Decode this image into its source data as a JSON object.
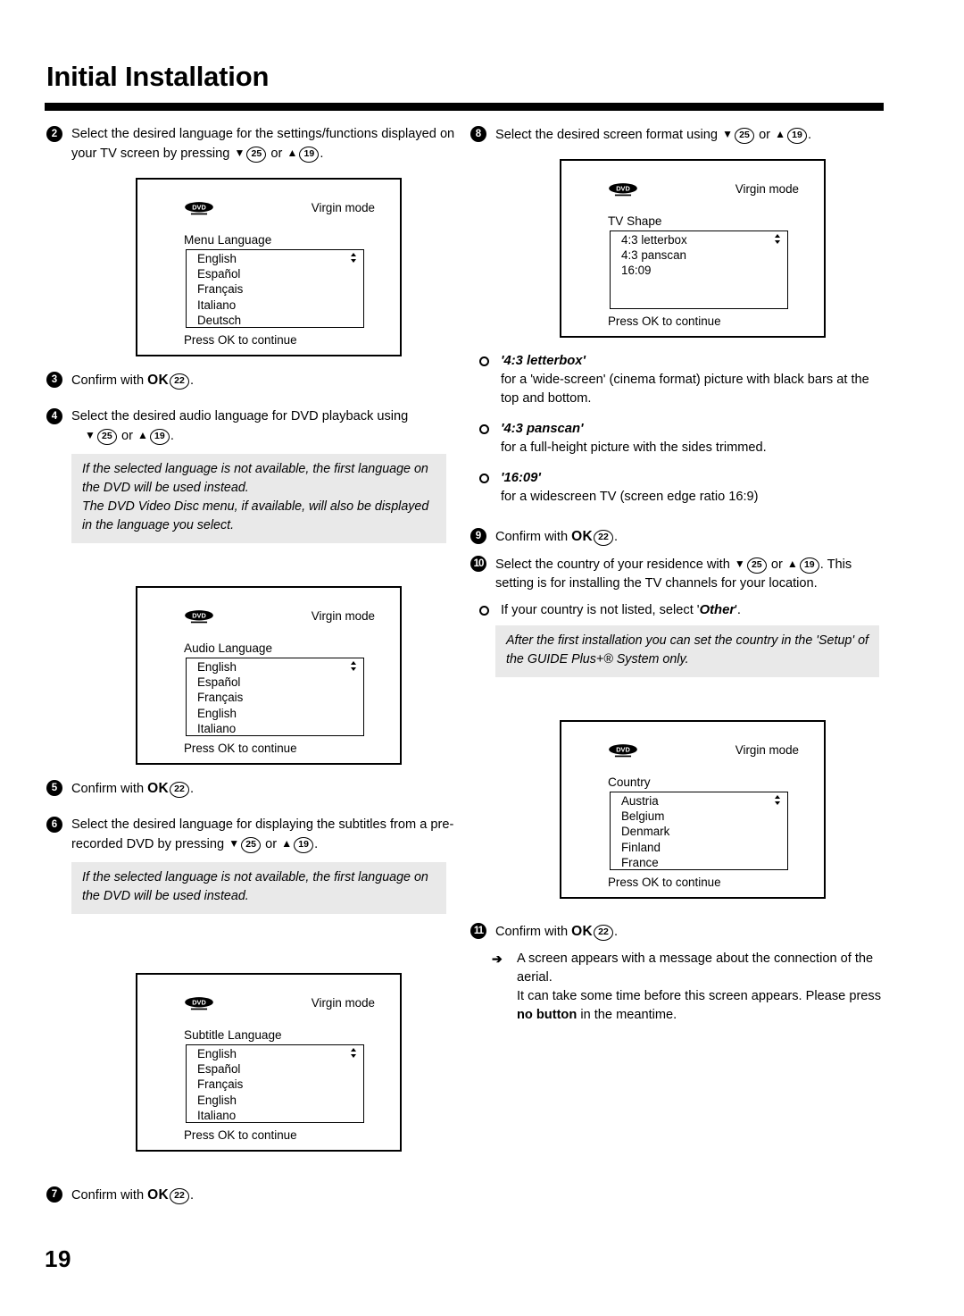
{
  "page": {
    "title": "Initial Installation",
    "number": "19"
  },
  "keys": {
    "down": "▼",
    "up": "▲",
    "key_down_num": "25",
    "key_up_num": "19",
    "key_ok_num": "22",
    "ok_label": "OK",
    "or": "or",
    "period": ".",
    "result_arrow": "➔"
  },
  "left_column": {
    "step2": {
      "badge": "2",
      "text_before": "Select the desired language for the settings/functions displayed on your TV screen by pressing"
    },
    "screen_menu_language": {
      "logo": "dvd-logo",
      "mode": "Virgin mode",
      "label": "Menu Language",
      "items": [
        "English",
        "Español",
        "Français",
        "Italiano",
        "Deutsch"
      ],
      "footer": "Press OK to continue"
    },
    "step3": {
      "badge": "3",
      "text_before": "Confirm with"
    },
    "step4": {
      "badge": "4",
      "text_before": "Select the desired audio language for DVD playback using"
    },
    "note4": [
      "If the selected language is not available, the first language on the DVD will be used instead.",
      "The DVD Video Disc menu, if available, will also be displayed in the language you select."
    ],
    "screen_audio_language": {
      "logo": "dvd-logo",
      "mode": "Virgin mode",
      "label": "Audio Language",
      "items": [
        "English",
        "Español",
        "Français",
        "English",
        "Italiano"
      ],
      "footer": "Press OK to continue"
    },
    "step5": {
      "badge": "5",
      "text_before": "Confirm with"
    },
    "step6": {
      "badge": "6",
      "text_before": "Select the desired language for displaying the subtitles from a pre-recorded DVD by pressing"
    },
    "note6": [
      "If the selected language is not available, the first language on the DVD will be used instead."
    ],
    "screen_subtitle_language": {
      "logo": "dvd-logo",
      "mode": "Virgin mode",
      "label": "Subtitle Language",
      "items": [
        "English",
        "Español",
        "Français",
        "English",
        "Italiano"
      ],
      "footer": "Press OK to continue"
    },
    "step7": {
      "badge": "7",
      "text_before": "Confirm with"
    }
  },
  "right_column": {
    "step8": {
      "badge": "8",
      "text_before": "Select the desired screen format using"
    },
    "screen_tv_shape": {
      "logo": "dvd-logo",
      "mode": "Virgin mode",
      "label": "TV Shape",
      "items": [
        "4:3 letterbox",
        "4:3 panscan",
        "16:09"
      ],
      "footer": "Press OK to continue"
    },
    "format_bullets": [
      {
        "head": "'4:3 letterbox'",
        "body": "for a 'wide-screen' (cinema format) picture with black bars at the top and bottom."
      },
      {
        "head": "'4:3 panscan'",
        "body": "for a full-height picture with the sides trimmed."
      },
      {
        "head": "'16:09'",
        "body": "for a widescreen TV (screen edge ratio 16:9)"
      }
    ],
    "step9": {
      "badge": "9",
      "text_before": "Confirm with"
    },
    "step10": {
      "badge": "10",
      "text_before": "Select the country of your residence with",
      "text_after": ". This setting is for installing the TV channels for your location.",
      "bullet_prefix": "If your country is not listed, select '",
      "bullet_emph": "Other",
      "bullet_suffix": "'."
    },
    "note10": [
      "After the first installation you can set the country in the 'Setup' of the GUIDE Plus+® System only."
    ],
    "screen_country": {
      "logo": "dvd-logo",
      "mode": "Virgin mode",
      "label": "Country",
      "items": [
        "Austria",
        "Belgium",
        "Denmark",
        "Finland",
        "France"
      ],
      "footer": "Press OK to continue"
    },
    "step11": {
      "badge": "11",
      "text_before": "Confirm with",
      "result_line1": "A screen appears with a message about the connection of the aerial.",
      "result_line2_a": "It can take some time before this screen appears. Please press ",
      "result_line2_b": "no button",
      "result_line2_c": " in the meantime."
    }
  }
}
